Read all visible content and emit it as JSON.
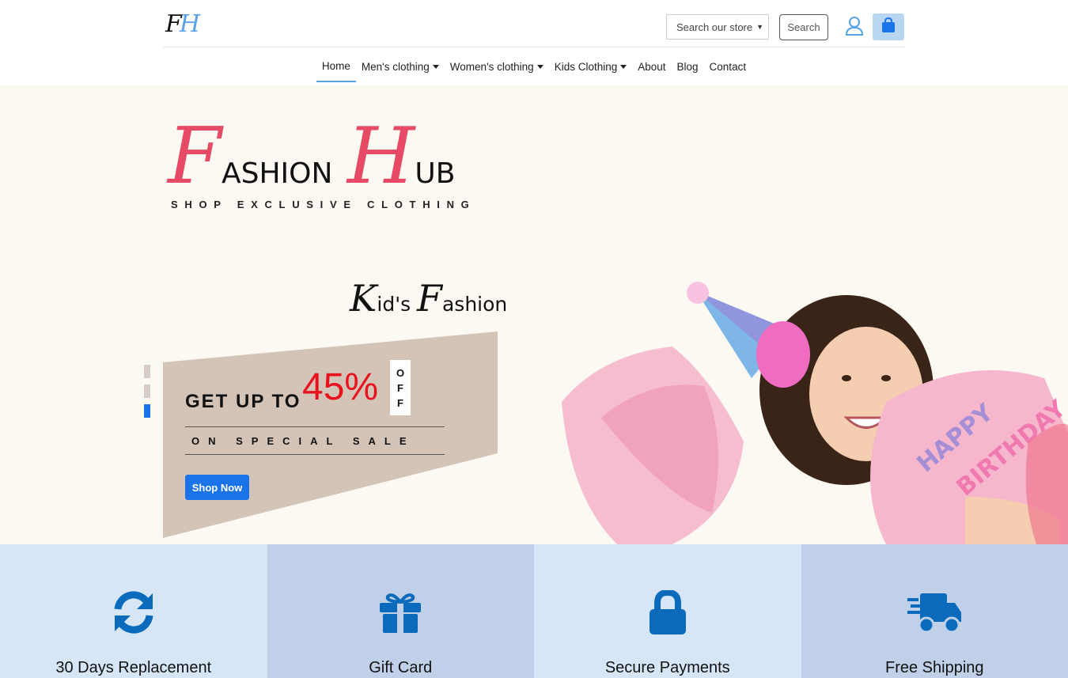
{
  "header": {
    "logo_f": "F",
    "logo_h": "H",
    "search_select_value": "Search our store",
    "search_button": "Search"
  },
  "nav": {
    "items": [
      {
        "label": "Home",
        "dropdown": false,
        "active": true
      },
      {
        "label": "Men's clothing",
        "dropdown": true,
        "active": false
      },
      {
        "label": "Women's clothing",
        "dropdown": true,
        "active": false
      },
      {
        "label": "Kids Clothing",
        "dropdown": true,
        "active": false
      },
      {
        "label": "About",
        "dropdown": false,
        "active": false
      },
      {
        "label": "Blog",
        "dropdown": false,
        "active": false
      },
      {
        "label": "Contact",
        "dropdown": false,
        "active": false
      }
    ]
  },
  "hero": {
    "brand_f": "F",
    "brand_ashion": "ASHION",
    "brand_h": "H",
    "brand_ub": "UB",
    "tagline": "SHOP EXCLUSIVE CLOTHING",
    "section_k": "K",
    "section_rest1": "id's ",
    "section_f": "F",
    "section_rest2": "ashion",
    "get_up_to": "GET UP TO",
    "percent": "45%",
    "off_letters": [
      "O",
      "F",
      "F"
    ],
    "special_sale": "ON SPECIAL SALE",
    "shop_now": "Shop Now",
    "slide_count": 3,
    "active_slide": 3
  },
  "features": [
    {
      "label": "30 Days Replacement",
      "icon": "refresh-icon"
    },
    {
      "label": "Gift Card",
      "icon": "gift-icon"
    },
    {
      "label": "Secure Payments",
      "icon": "lock-icon"
    },
    {
      "label": "Free Shipping",
      "icon": "truck-icon"
    }
  ],
  "colors": {
    "accent_blue": "#1a73e8",
    "brand_pink": "#e64a64",
    "sale_red": "#e8121c",
    "promo_bg": "#d4c3b7",
    "hero_bg": "#fcf9f3",
    "feature_light": "#d6e6f7",
    "feature_dark": "#c0d0e8",
    "icon_blue": "#0a6bbd"
  }
}
